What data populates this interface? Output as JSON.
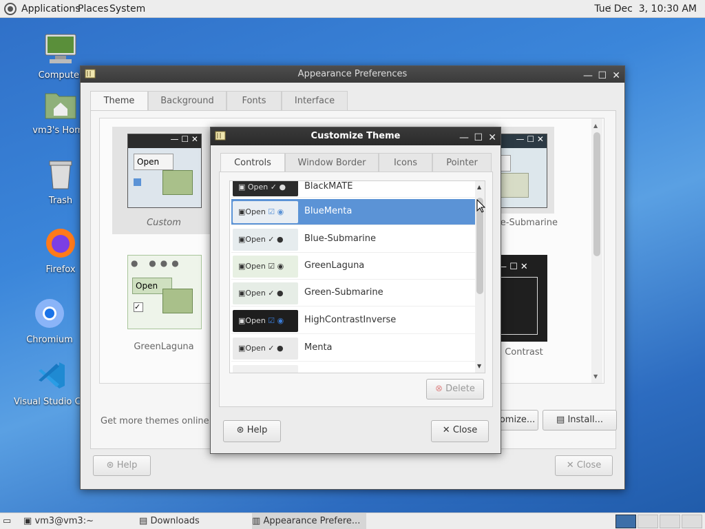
{
  "top_panel": {
    "menus": [
      "Applications",
      "Places",
      "System"
    ],
    "clock": "Tue Dec  3, 10:30 AM"
  },
  "desktop": {
    "icons": [
      {
        "label": "Computer",
        "icon": "computer-icon"
      },
      {
        "label": "vm3's Home",
        "icon": "home-folder-icon"
      },
      {
        "label": "Trash",
        "icon": "trash-icon"
      },
      {
        "label": "Firefox",
        "icon": "firefox-icon"
      },
      {
        "label": "Chromium",
        "icon": "chromium-icon"
      },
      {
        "label": "Visual Studio Code",
        "icon": "vscode-icon"
      }
    ]
  },
  "appearance": {
    "title": "Appearance Preferences",
    "tabs": [
      "Theme",
      "Background",
      "Fonts",
      "Interface"
    ],
    "themes": [
      "Custom",
      "Blue-Submarine",
      "GreenLaguna",
      "HighContrast"
    ],
    "thumb_open": "Open",
    "get_more": "Get more themes online",
    "customize": "Customize...",
    "install": "Install...",
    "help": "Help",
    "close": "Close"
  },
  "customize": {
    "title": "Customize Theme",
    "tabs": [
      "Controls",
      "Window Border",
      "Icons",
      "Pointer"
    ],
    "preview_open": "Open",
    "items": [
      {
        "name": "BlackMATE",
        "style": "dark"
      },
      {
        "name": "BlueMenta",
        "style": "blue",
        "selected": true
      },
      {
        "name": "Blue-Submarine",
        "style": "light"
      },
      {
        "name": "GreenLaguna",
        "style": "green"
      },
      {
        "name": "Green-Submarine",
        "style": "light"
      },
      {
        "name": "HighContrastInverse",
        "style": "dark"
      },
      {
        "name": "Menta",
        "style": "light"
      }
    ],
    "delete": "Delete",
    "help": "Help",
    "close": "Close"
  },
  "taskbar": {
    "tasks": [
      "vm3@vm3:~",
      "Downloads",
      "Appearance Prefere..."
    ]
  },
  "colors": {
    "accent": "#5b93d6",
    "titlebar": "#3f3f3f"
  }
}
